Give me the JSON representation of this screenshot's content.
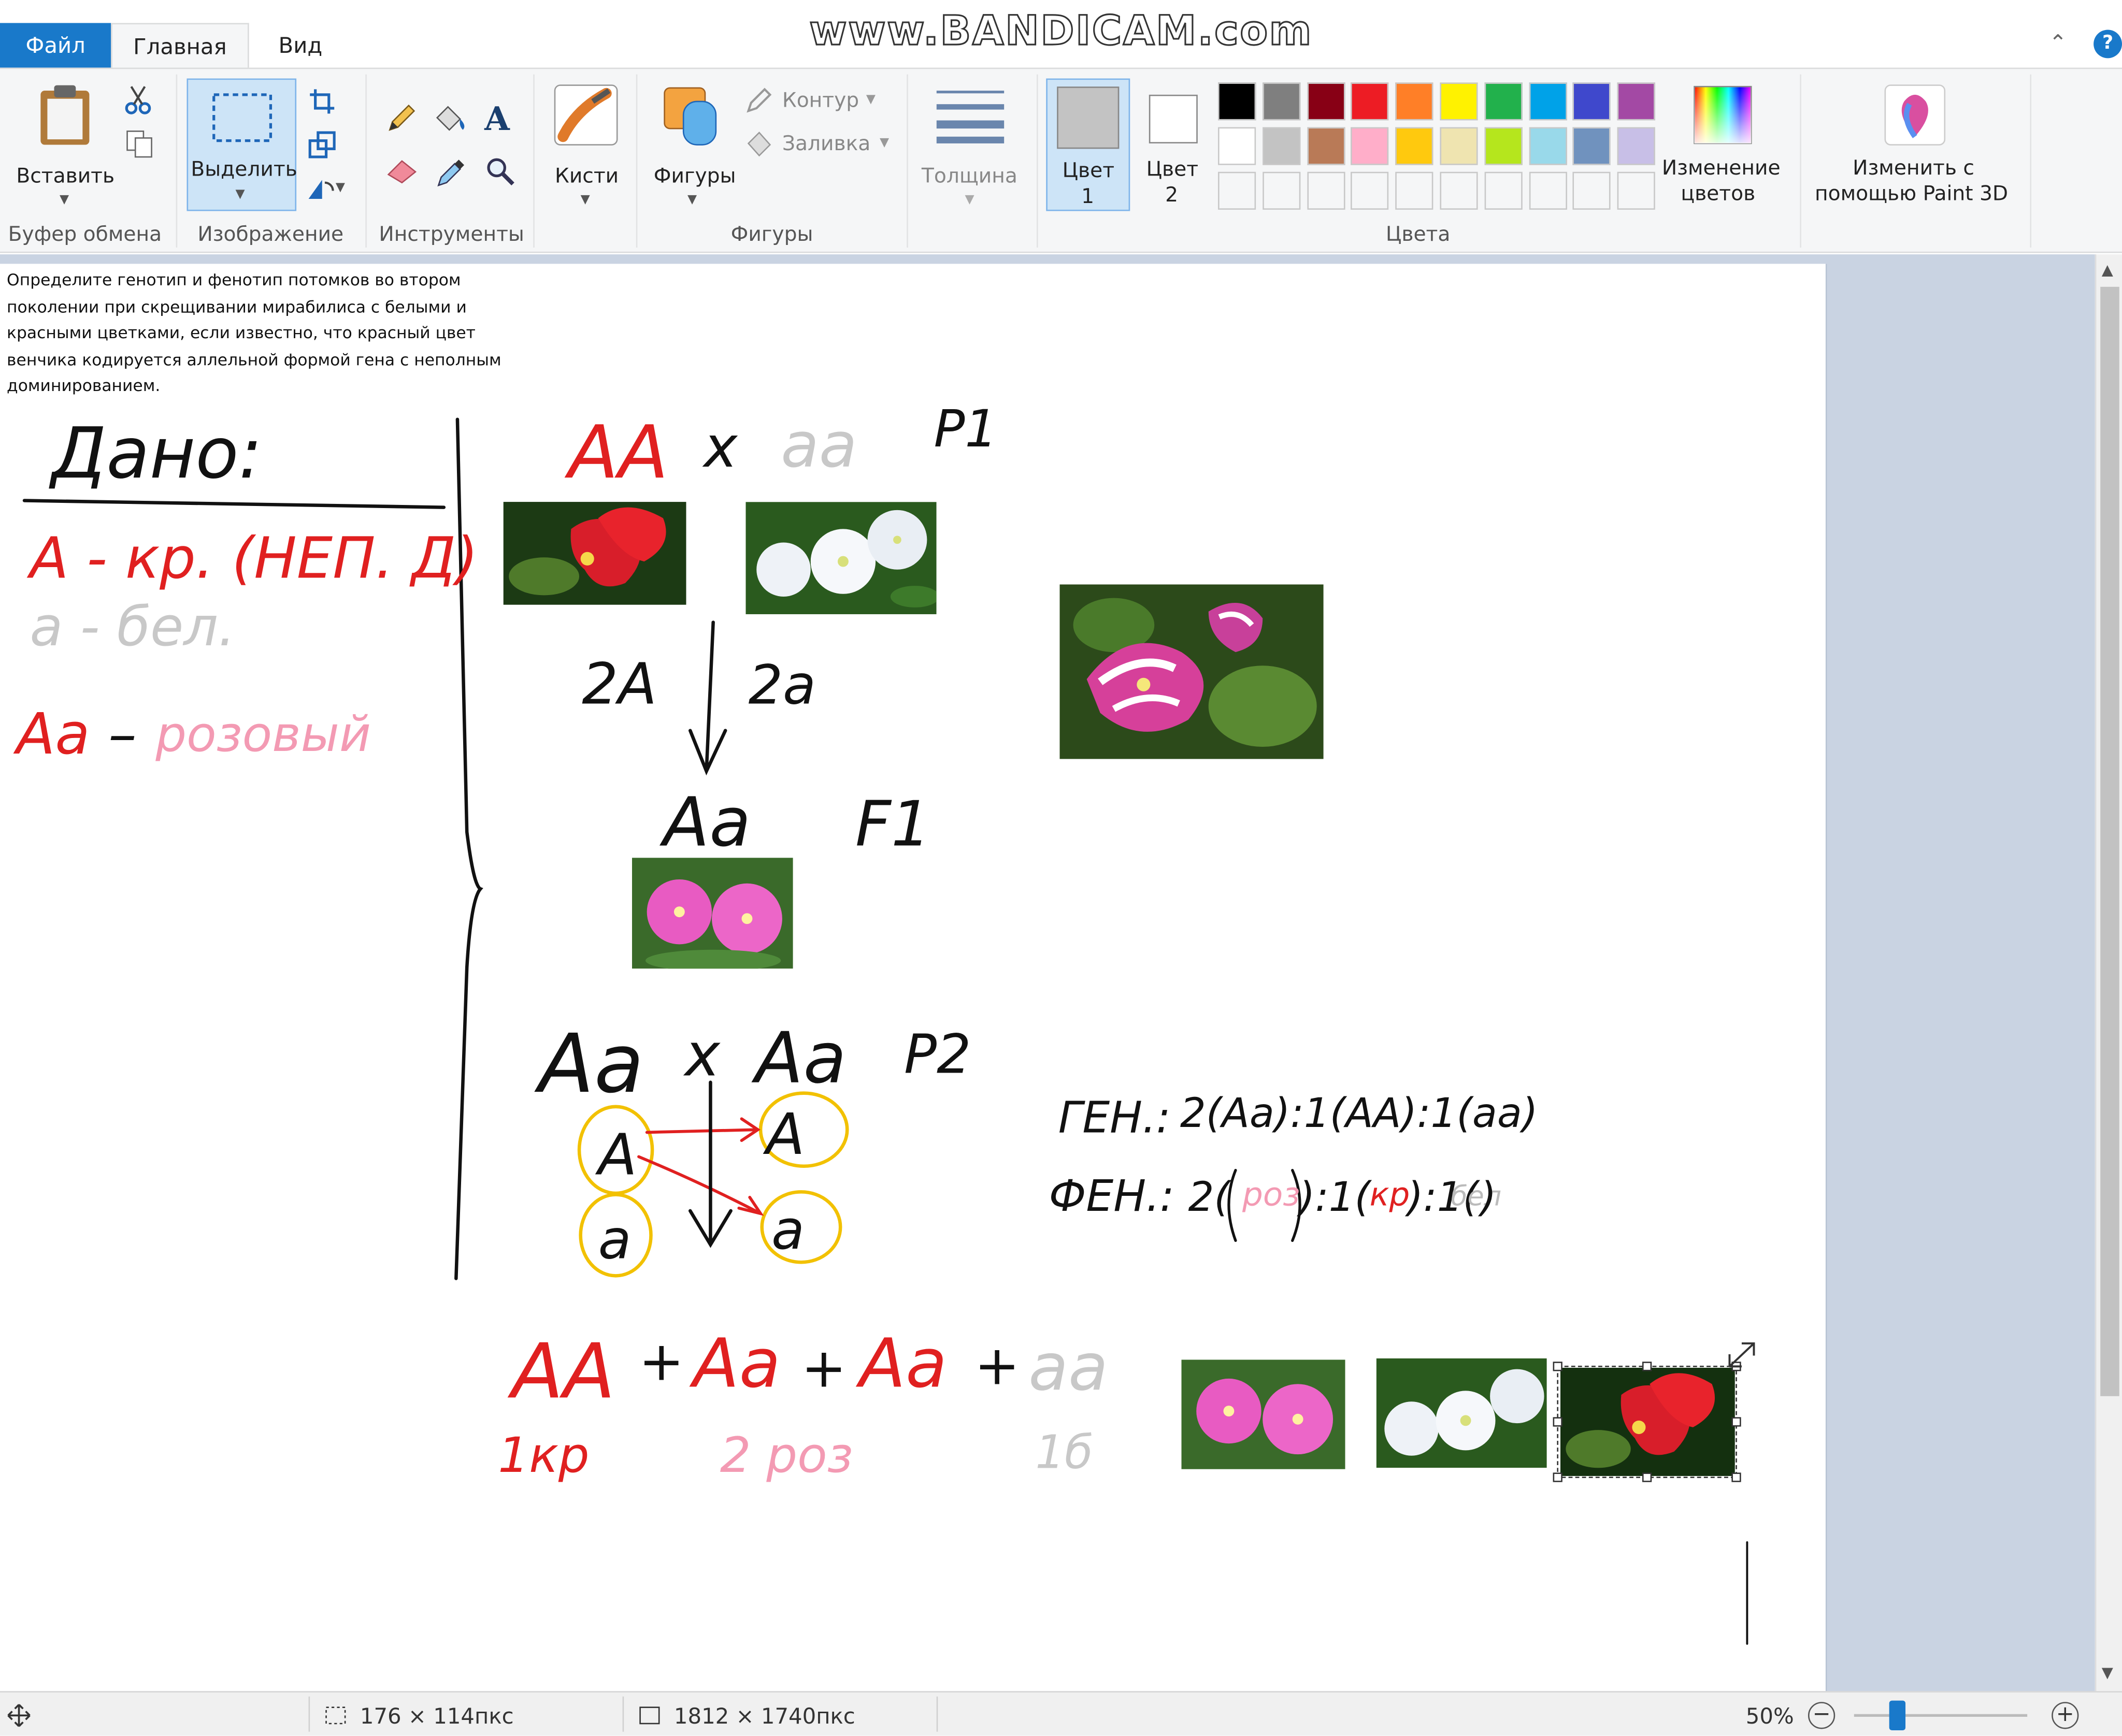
{
  "tabs": {
    "file": "Файл",
    "home": "Главная",
    "view": "Вид"
  },
  "watermark": "www.BANDICAM.com",
  "ribbon": {
    "clipboard": {
      "paste": "Вставить",
      "group": "Буфер обмена"
    },
    "image": {
      "select": "Выделить",
      "group": "Изображение"
    },
    "tools": {
      "group": "Инструменты"
    },
    "brushes": {
      "label": "Кисти"
    },
    "shapes": {
      "shapes": "Фигуры",
      "outline": "Контур",
      "fill": "Заливка",
      "group": "Фигуры"
    },
    "thickness": {
      "label": "Толщина"
    },
    "color1": {
      "line1": "Цвет",
      "line2": "1",
      "color": "#c3c3c3"
    },
    "color2": {
      "line1": "Цвет",
      "line2": "2",
      "color": "#ffffff"
    },
    "colors_group": "Цвета",
    "palette_row1": [
      "#000000",
      "#7f7f7f",
      "#880015",
      "#ed1c24",
      "#ff7f27",
      "#fff200",
      "#22b14c",
      "#00a2e8",
      "#3f48cc",
      "#a349a4"
    ],
    "palette_row2": [
      "#ffffff",
      "#c3c3c3",
      "#b97a57",
      "#ffaec9",
      "#ffc90e",
      "#efe4b0",
      "#b5e61d",
      "#99d9ea",
      "#7092be",
      "#c8bfe7"
    ],
    "edit_colors": {
      "line1": "Изменение",
      "line2": "цветов"
    },
    "paint3d": {
      "line1": "Изменить с",
      "line2": "помощью Paint 3D"
    }
  },
  "canvas": {
    "task_text": "Определите генотип и фенотип потомков во втором поколении при скрещивании мирабилиса с белыми и красными цветками, если известно, что красный цвет венчика кодируется аллельной формой гена с неполным доминированием.",
    "handwriting": {
      "dano": "Дано:",
      "gene_a": "А - кр. (НЕП. Д)",
      "gene_a_small": "а - бел.",
      "aa_label": "Аа",
      "pink_word": "розовый",
      "p1_left": "АА",
      "p1_x": "x",
      "p1_right": "аа",
      "p1_label": "P1",
      "gamete_a": "2А",
      "gamete_aa": "2а",
      "f1_geno": "Аа",
      "f1_label": "F1",
      "p2_left": "Аа",
      "p2_x": "x",
      "p2_right": "Аа",
      "p2_label": "P2",
      "g1": "А",
      "g2": "а",
      "g3": "А",
      "g4": "а",
      "gen_label": "ГЕН.:",
      "gen_ratio": "2(Аа):1(АА):1(аа)",
      "fen_label": "ФЕН.:",
      "fen_2": "2(",
      "fen_roz": "роз",
      "fen_1a": "):1(",
      "fen_kr": "кр",
      "fen_1b": "):1(",
      "fen_bel": "бел",
      "fen_end": ")",
      "r_aa": "АА",
      "r_plus1": "+",
      "r_Aa1": "Аа",
      "r_plus2": "+",
      "r_Aa2": "Аа",
      "r_plus3": "+",
      "r_aa2": "аа",
      "r_1kr": "1кр",
      "r_2roz": "2 роз",
      "r_1b": "1б"
    }
  },
  "status": {
    "selection_size": "176 × 114пкс",
    "image_size": "1812 × 1740пкс",
    "zoom": "50%"
  }
}
